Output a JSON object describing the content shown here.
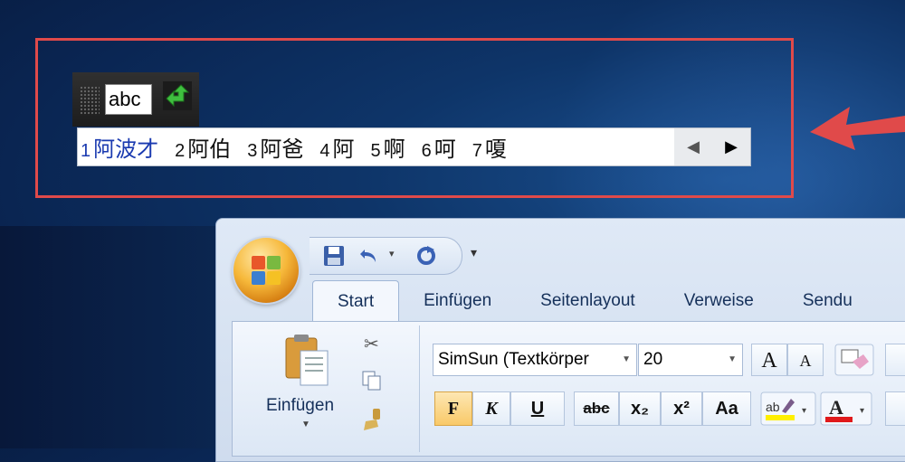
{
  "ime": {
    "input_text": "abc",
    "candidates": [
      {
        "num": "1",
        "text": "阿波才"
      },
      {
        "num": "2",
        "text": "阿伯"
      },
      {
        "num": "3",
        "text": "阿爸"
      },
      {
        "num": "4",
        "text": "阿"
      },
      {
        "num": "5",
        "text": "啊"
      },
      {
        "num": "6",
        "text": "呵"
      },
      {
        "num": "7",
        "text": "嗄"
      }
    ],
    "nav_prev": "◀",
    "nav_next": "▶"
  },
  "word": {
    "tabs": [
      "Start",
      "Einfügen",
      "Seitenlayout",
      "Verweise",
      "Sendu"
    ],
    "clipboard": {
      "paste_label": "Einfügen"
    },
    "font": {
      "name": "SimSun (Textkörper",
      "size": "20"
    },
    "format_buttons": {
      "bold": "F",
      "italic": "K",
      "underline": "U",
      "strike": "abc",
      "subscript": "x₂",
      "superscript": "x²",
      "case": "Aa",
      "grow": "A",
      "shrink": "A"
    }
  },
  "colors": {
    "highlight": "#e04a4a",
    "desktop": "#0e3569",
    "selected_candidate": "#1a3ab0"
  }
}
